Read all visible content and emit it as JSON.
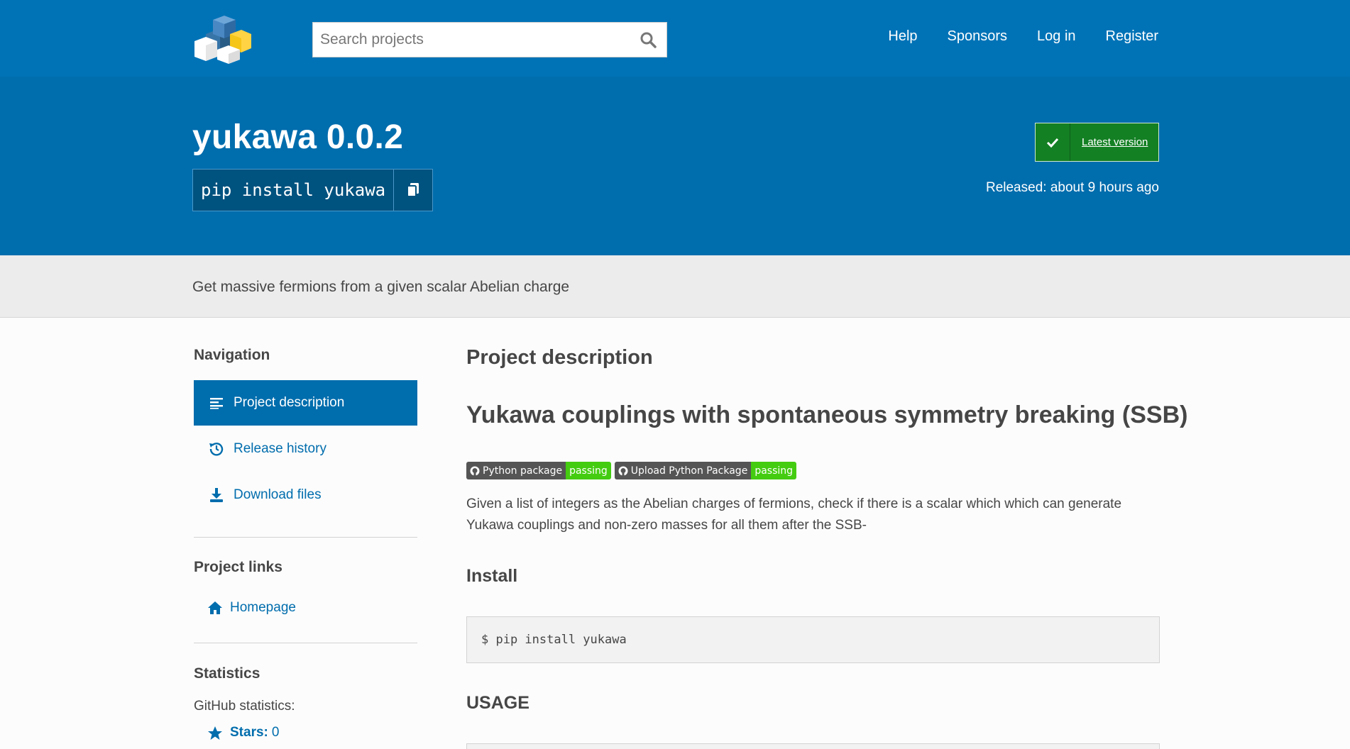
{
  "header": {
    "search_placeholder": "Search projects",
    "nav": [
      "Help",
      "Sponsors",
      "Log in",
      "Register"
    ]
  },
  "banner": {
    "title": "yukawa 0.0.2",
    "pip_command": "pip install yukawa",
    "latest_label": "Latest version",
    "released": "Released: about 9 hours ago"
  },
  "summary": "Get massive fermions from a given scalar Abelian charge",
  "sidebar": {
    "navigation_heading": "Navigation",
    "nav_items": [
      "Project description",
      "Release history",
      "Download files"
    ],
    "project_links_heading": "Project links",
    "homepage_label": "Homepage",
    "statistics_heading": "Statistics",
    "github_stats_label": "GitHub statistics:",
    "stars_label": "Stars:",
    "stars_count": "0"
  },
  "content": {
    "heading": "Project description",
    "readme_title": "Yukawa couplings with spontaneous symmetry breaking (SSB)",
    "badges": [
      {
        "label": "Python package",
        "status": "passing"
      },
      {
        "label": "Upload Python Package",
        "status": "passing"
      }
    ],
    "paragraph": "Given a list of integers as the Abelian charges of fermions, check if there is a scalar which which can generate Yukawa couplings and non-zero masses for all them after the SSB-",
    "install_heading": "Install",
    "install_code": "$ pip install yukawa",
    "usage_heading": "USAGE"
  },
  "colors": {
    "header_blue": "#0073b7",
    "banner_blue": "#006dad",
    "latest_green": "#148024",
    "badge_green": "#44cc11"
  }
}
